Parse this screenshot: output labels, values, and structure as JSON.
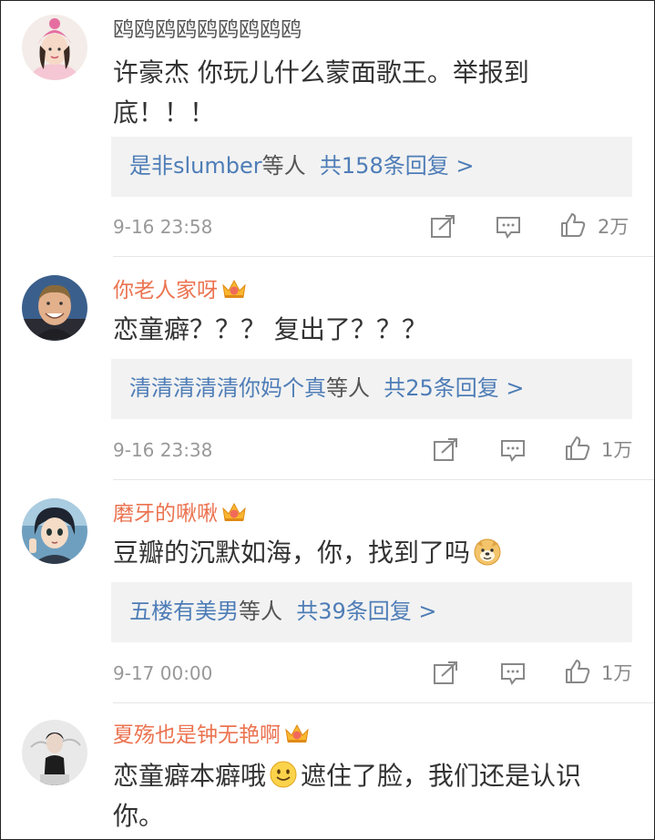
{
  "comments": [
    {
      "username": "鸥鸥鸥鸥鸥鸥鸥鸥鸥",
      "vip": false,
      "text_line1": "许豪杰 你玩儿什么蒙面歌王。举报到",
      "text_line2": "底！！！",
      "reply_users": "是非slumber",
      "reply_suffix": "等人",
      "reply_count": "共158条回复 >",
      "time": "9-16 23:58",
      "likes": "2万",
      "icons": [
        "forward-icon",
        "comment-icon",
        "like-icon"
      ]
    },
    {
      "username": "你老人家呀",
      "vip": true,
      "text_line1": "恋童癖？？？ 复出了？？？",
      "reply_users": "清清清清清你妈个真",
      "reply_suffix": "等人",
      "reply_count": "共25条回复 >",
      "time": "9-16 23:38",
      "likes": "1万"
    },
    {
      "username": "磨牙的啾啾",
      "vip": true,
      "text_line1": "豆瓣的沉默如海，你，找到了吗",
      "emoji": "doge-emoji",
      "reply_users": "五楼有美男",
      "reply_suffix": "等人",
      "reply_count": "共39条回复 >",
      "time": "9-17 00:00",
      "likes": "1万"
    },
    {
      "username": "夏殇也是钟无艳啊",
      "vip": true,
      "text_part1": "恋童癖本癖哦",
      "emoji": "smile-emoji",
      "text_part2": "遮住了脸，我们还是认识",
      "text_line2": "你。"
    }
  ],
  "colors": {
    "vip_name": "#eb7350",
    "link": "#4e7db7",
    "reply_bg": "#f2f2f2",
    "meta": "#999999"
  }
}
